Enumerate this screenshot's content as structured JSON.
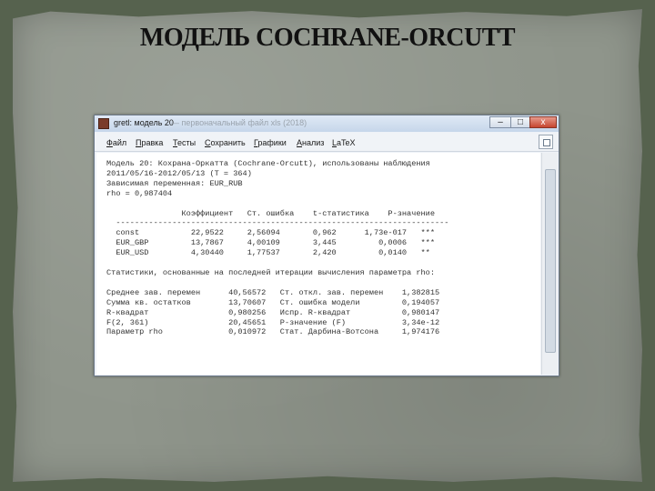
{
  "slide": {
    "title": "МОДЕЛЬ COCHRANE-ORCUTT"
  },
  "window": {
    "title": "gretl: модель 20",
    "title_extra": "— первоначальный файл xls (2018)",
    "controls": {
      "minimize": "–",
      "maximize": "□",
      "close": "x"
    }
  },
  "menu": {
    "items": [
      "Файл",
      "Правка",
      "Тесты",
      "Сохранить",
      "Графики",
      "Анализ",
      "LaTeX"
    ]
  },
  "icons": {
    "app": "gretl-app-icon",
    "toolbar": "window-toolbar-icon"
  },
  "output": {
    "header": {
      "line1": "Модель 20: Кохрана-Оркатта (Cochrane-Orcutt), использованы наблюдения",
      "line2": "2011/05/16-2012/05/13 (T = 364)",
      "line3": "Зависимая переменная: EUR_RUB",
      "line4": "rho = 0,987404"
    },
    "table": {
      "columns": [
        "Коэффициент",
        "Ст. ошибка",
        "t-статистика",
        "P-значение"
      ],
      "rows": [
        {
          "name": "const",
          "coef": "22,9522",
          "se": "2,56094",
          "t": "0,962",
          "p": "1,73e-017",
          "sig": "***"
        },
        {
          "name": "EUR_GBP",
          "coef": "13,7867",
          "se": "4,00109",
          "t": "3,445",
          "p": "0,0006",
          "sig": "***"
        },
        {
          "name": "EUR_USD",
          "coef": "4,30440",
          "se": "1,77537",
          "t": "2,420",
          "p": "0,0140",
          "sig": "**"
        }
      ]
    },
    "note": "Статистики, основанные на последней итерации вычисления параметра rho:",
    "stats": [
      {
        "l1": "Среднее зав. перемен",
        "v1": "40,56572",
        "l2": "Ст. откл. зав. перемен",
        "v2": "1,382815"
      },
      {
        "l1": "Сумма кв. остатков",
        "v1": "13,70607",
        "l2": "Ст. ошибка модели",
        "v2": "0,194057"
      },
      {
        "l1": "R-квадрат",
        "v1": "0,980256",
        "l2": "Испр. R-квадрат",
        "v2": "0,980147"
      },
      {
        "l1": "F(2, 361)",
        "v1": "20,45651",
        "l2": "Р-значение (F)",
        "v2": "3,34e-12"
      },
      {
        "l1": "Параметр rho",
        "v1": "0,010972",
        "l2": "Стат. Дарбина-Вотсона",
        "v2": "1,974176"
      }
    ]
  }
}
